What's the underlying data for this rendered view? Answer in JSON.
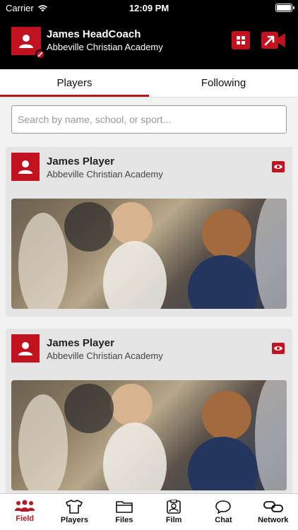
{
  "status_bar": {
    "carrier": "Carrier",
    "time": "12:09 PM"
  },
  "profile": {
    "name": "James HeadCoach",
    "school": "Abbeville Christian Academy"
  },
  "tabs": [
    {
      "label": "Players",
      "active": true
    },
    {
      "label": "Following",
      "active": false
    }
  ],
  "search": {
    "placeholder": "Search by name, school, or sport..."
  },
  "players": [
    {
      "name": "James Player",
      "school": "Abbeville Christian Academy"
    },
    {
      "name": "James Player",
      "school": "Abbeville Christian Academy"
    }
  ],
  "nav": [
    {
      "label": "Field",
      "icon": "people-icon",
      "active": true
    },
    {
      "label": "Players",
      "icon": "jersey-icon",
      "active": false
    },
    {
      "label": "Files",
      "icon": "folder-icon",
      "active": false
    },
    {
      "label": "Film",
      "icon": "film-icon",
      "active": false
    },
    {
      "label": "Chat",
      "icon": "chat-icon",
      "active": false
    },
    {
      "label": "Network",
      "icon": "link-icon",
      "active": false
    }
  ],
  "colors": {
    "accent": "#c1121f",
    "header_bg": "#000000",
    "card_bg": "#e4e4e4"
  }
}
